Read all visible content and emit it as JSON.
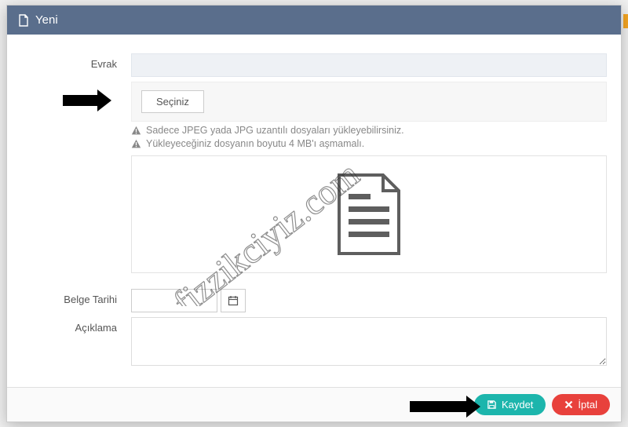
{
  "modal": {
    "title": "Yeni"
  },
  "form": {
    "evrak_label": "Evrak",
    "evrak_value": "",
    "select_button": "Seçiniz",
    "hint1": "Sadece JPEG yada JPG uzantılı dosyaları yükleyebilirsiniz.",
    "hint2": "Yükleyeceğiniz dosyanın boyutu 4 MB'ı aşmamalı.",
    "belge_tarihi_label": "Belge Tarihi",
    "belge_tarihi_value": "",
    "aciklama_label": "Açıklama",
    "aciklama_value": ""
  },
  "footer": {
    "save_label": "Kaydet",
    "cancel_label": "İptal"
  },
  "watermark_text": "fizzikciyiz.com"
}
